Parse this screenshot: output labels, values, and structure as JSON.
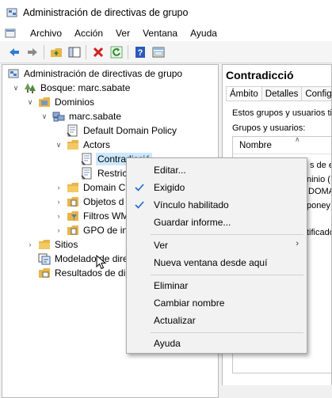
{
  "window": {
    "title": "Administración de directivas de grupo",
    "menu": [
      "Archivo",
      "Acción",
      "Ver",
      "Ventana",
      "Ayuda"
    ]
  },
  "toolbar": {
    "buttons": [
      "back-icon",
      "forward-icon",
      "up-folder-icon",
      "show-hide-tree-icon",
      "delete-icon",
      "refresh-icon",
      "help-icon",
      "console-icon"
    ]
  },
  "tree": {
    "root": "Administración de directivas de grupo",
    "forest": "Bosque: marc.sabate",
    "domains": "Dominios",
    "domain": "marc.sabate",
    "default_policy": "Default Domain Policy",
    "actors": "Actors",
    "contradiccio": "Contradicció",
    "restric": "Restric",
    "domain_controllers": "Domain C",
    "objects": "Objetos d",
    "wmi_filters": "Filtros WM",
    "gpo": "GPO de in",
    "sites": "Sitios",
    "modeling": "Modelado de dire",
    "results": "Resultados de dire"
  },
  "right_pane": {
    "title": "Contradicció",
    "tabs": [
      "Ámbito",
      "Detalles",
      "Configu"
    ],
    "text1": "Estos grupos y usuarios tie",
    "text2": "Grupos y usuarios:",
    "column": "Nombre",
    "frag1": "s de en",
    "frag2": "ninio (N",
    "frag3": "DOMA",
    "frag4": "poney (",
    "frag5": "tificado"
  },
  "context_menu": {
    "items": [
      {
        "label": "Editar...",
        "checked": false
      },
      {
        "label": "Exigido",
        "checked": true
      },
      {
        "label": "Vínculo habilitado",
        "checked": true
      },
      {
        "label": "Guardar informe...",
        "checked": false
      },
      {
        "label": "Ver",
        "submenu": true
      },
      {
        "label": "Nueva ventana desde aquí"
      },
      {
        "label": "Eliminar"
      },
      {
        "label": "Cambiar nombre"
      },
      {
        "label": "Actualizar"
      },
      {
        "label": "Ayuda"
      }
    ]
  },
  "colors": {
    "check": "#1a66cc",
    "selection": "#cce8ff",
    "folder": "#e8b548"
  }
}
